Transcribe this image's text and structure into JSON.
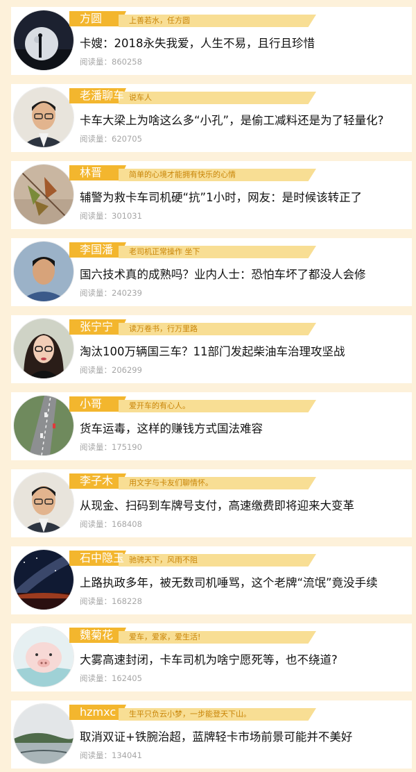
{
  "meta_label": "阅读量：",
  "items": [
    {
      "name": "方圆",
      "signature": "上善若水，任方圆",
      "headline": "卡嫂：2018永失我爱，人生不易，且行且珍惜",
      "reads": "860258",
      "avatar": "moon-night-photo"
    },
    {
      "name": "老潘聊车",
      "signature": "说车人",
      "headline": "卡车大梁上为啥这么多“小孔”，是偷工减料还是为了轻量化?",
      "reads": "620705",
      "avatar": "man-glasses-portrait"
    },
    {
      "name": "林晋",
      "signature": "简单的心境才能拥有快乐的心情",
      "headline": "辅警为救卡车司机硬“抗”1小时，网友：是时候该转正了",
      "reads": "301031",
      "avatar": "autumn-leaves-photo"
    },
    {
      "name": "李国潘",
      "signature": "老司机正常操作 坐下",
      "headline": "国六技术真的成熟吗？业内人士：恐怕车坏了都没人会修",
      "reads": "240239",
      "avatar": "young-man-portrait"
    },
    {
      "name": "张宁宁",
      "signature": "读万卷书，行万里路",
      "headline": "淘汰100万辆国三车？11部门发起柴油车治理攻坚战",
      "reads": "206299",
      "avatar": "woman-glasses-portrait"
    },
    {
      "name": "小哥",
      "signature": "爱开车的有心人。",
      "headline": "货车运毒，这样的赚钱方式国法难容",
      "reads": "175190",
      "avatar": "highway-aerial-photo"
    },
    {
      "name": "李子木",
      "signature": "用文字与卡友们聊情怀。",
      "headline": "从现金、扫码到车牌号支付，高速缴费即将迎来大变革",
      "reads": "168408",
      "avatar": "man-glasses-portrait"
    },
    {
      "name": "石中隐玉",
      "signature": "驰骋天下，风雨不阻",
      "headline": "上路执政多年，被无数司机唾骂，这个老牌“流氓”竟没手续",
      "reads": "168228",
      "avatar": "milky-way-photo"
    },
    {
      "name": "魏菊花",
      "signature": "爱车，爱家，爱生活!",
      "headline": "大雾高速封闭，卡车司机为啥宁愿死等，也不绕道?",
      "reads": "162405",
      "avatar": "cartoon-pig-avatar"
    },
    {
      "name": "hzmxc",
      "signature": "生平只负云小梦，一步能登天下山。",
      "headline": "取消双证+铁腕治超，蓝牌轻卡市场前景可能并不美好",
      "reads": "134041",
      "avatar": "lake-landscape-photo"
    }
  ]
}
